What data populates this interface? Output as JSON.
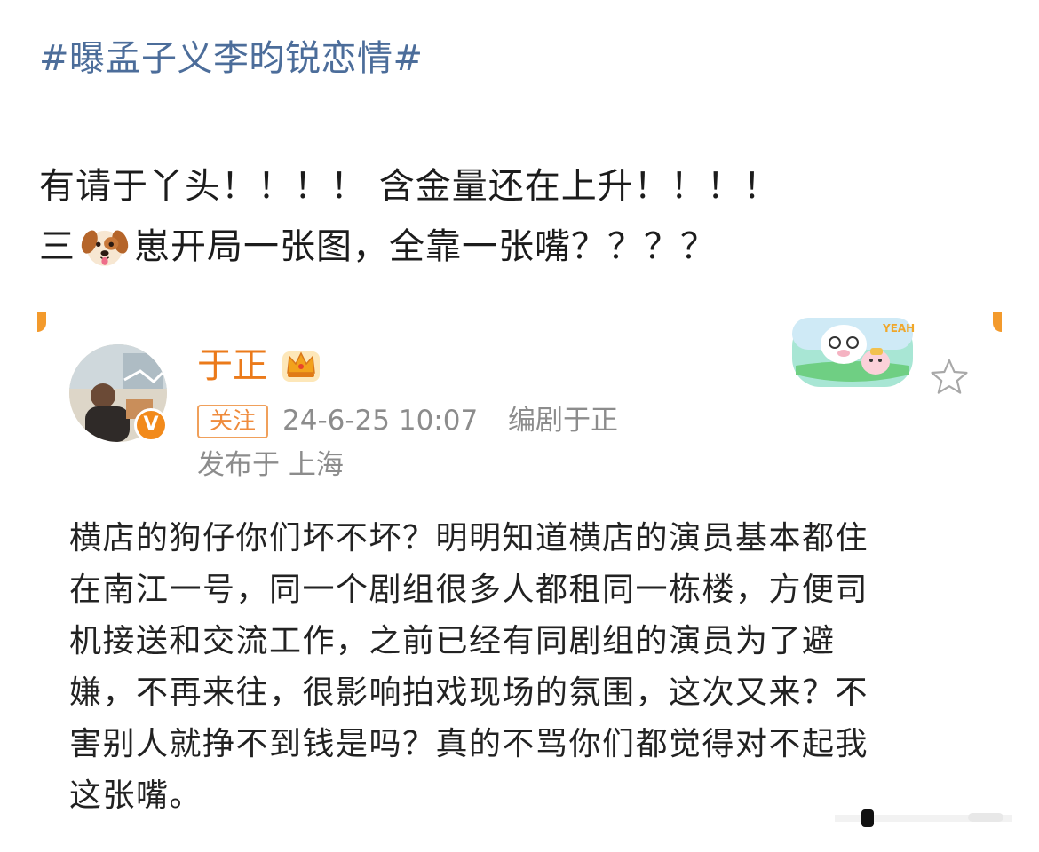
{
  "topic": "#曝孟子义李昀锐恋情#",
  "post": {
    "line1": "有请于丫头！！！！ 含金量还在上升！！！！",
    "line2_prefix": "三",
    "line2_emoji": "dog-face-icon",
    "line2_suffix": "崽开局一张图，全靠一张嘴？？？？"
  },
  "embedded_post": {
    "username": "于正",
    "follow_label": "关注",
    "timestamp": "24-6-25 10:07",
    "source": "编剧于正",
    "location": "发布于 上海",
    "verified_badge": "V",
    "body_lines": [
      "横店的狗仔你们坏不坏？明明知道横店的演员基本都住",
      "在南江一号，同一个剧组很多人都租同一栋楼，方便司",
      "机接送和交流工作，之前已经有同剧组的演员为了避",
      "嫌，不再来往，很影响拍戏现场的氛围，这次又来？不",
      "害别人就挣不到钱是吗？真的不骂你们都觉得对不起我",
      "这张嘴。"
    ],
    "sticker_text": "YEAH!"
  },
  "colors": {
    "topic": "#4c6d9a",
    "username": "#eb7a1a",
    "accent": "#f39a2c",
    "meta": "#8c8c8c"
  }
}
